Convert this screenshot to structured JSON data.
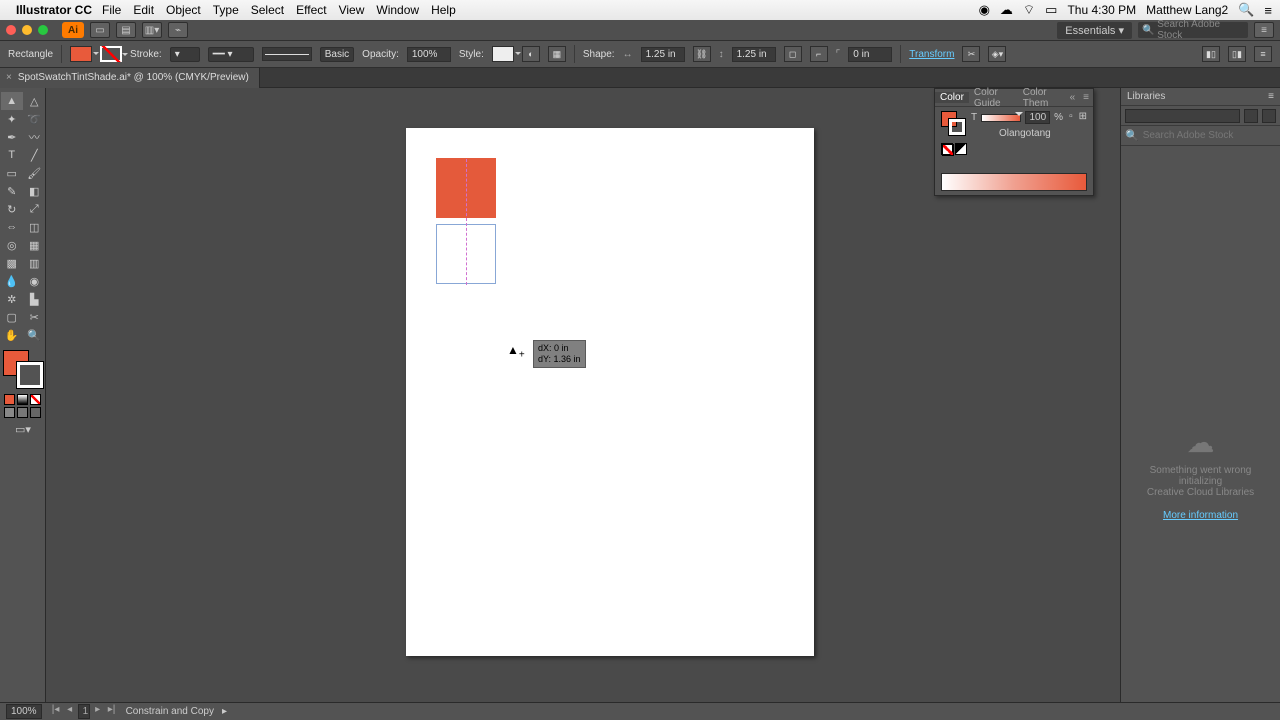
{
  "menubar": {
    "app": "Illustrator CC",
    "items": [
      "File",
      "Edit",
      "Object",
      "Type",
      "Select",
      "Effect",
      "View",
      "Window",
      "Help"
    ],
    "time": "Thu 4:30 PM",
    "user": "Matthew Lang2"
  },
  "window": {
    "ai_badge": "Ai",
    "workspace": "Essentials",
    "stock_placeholder": "Search Adobe Stock"
  },
  "ctrl": {
    "tool": "Rectangle",
    "fill": "#e85a3b",
    "stroke_label": "Stroke:",
    "stroke_pt": "",
    "basic_label": "Basic",
    "opacity_label": "Opacity:",
    "opacity": "100%",
    "style_label": "Style:",
    "shape_label": "Shape:",
    "w": "1.25 in",
    "h": "1.25 in",
    "corner": "0 in",
    "transform": "Transform"
  },
  "tab": {
    "title": "SpotSwatchTintShade.ai* @ 100% (CMYK/Preview)"
  },
  "smartguide": {
    "dx": "dX: 0 in",
    "dy": "dY: 1.36 in"
  },
  "color_panel": {
    "tabs": [
      "Color",
      "Color Guide",
      "Color Them"
    ],
    "letter": "T",
    "tint": "100",
    "pct": "%",
    "name": "Olangotang"
  },
  "libraries": {
    "title": "Libraries",
    "search_placeholder": "Search Adobe Stock",
    "err1": "Something went wrong initializing",
    "err2": "Creative Cloud Libraries",
    "more": "More information"
  },
  "status": {
    "zoom": "100%",
    "artboard": "1",
    "hint": "Constrain and Copy"
  },
  "chart_data": null
}
